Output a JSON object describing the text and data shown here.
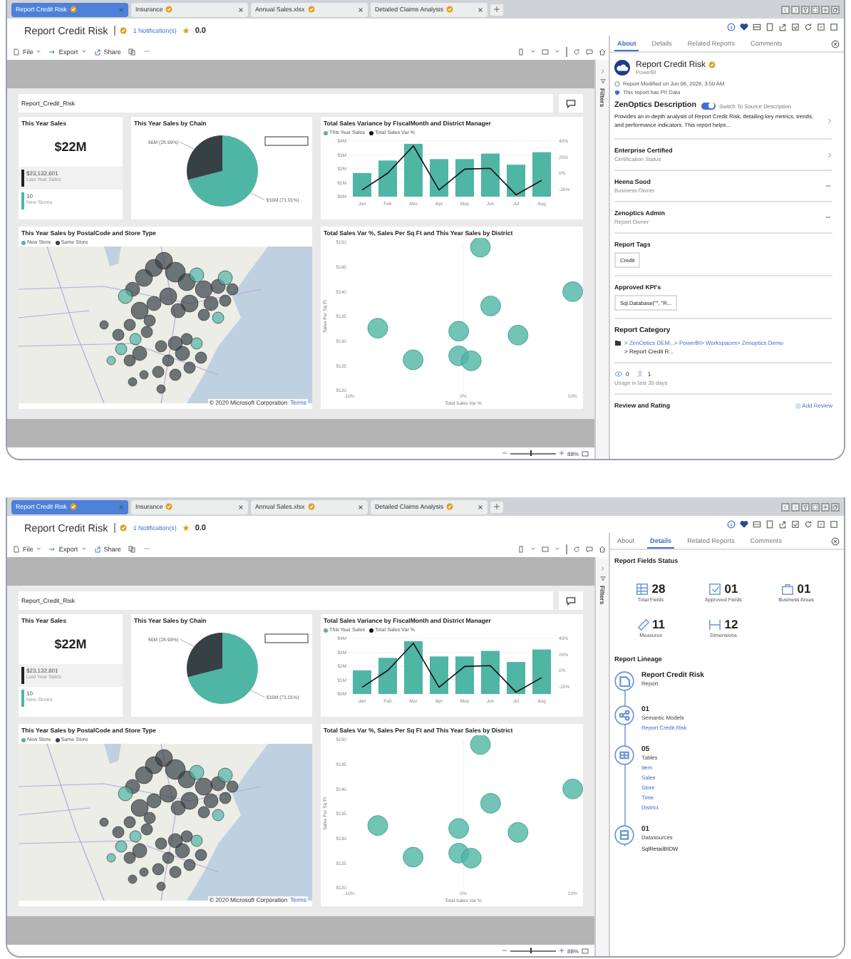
{
  "windows": [
    {
      "tabs": [
        {
          "label": "Report Credit Risk",
          "selected": true
        },
        {
          "label": "Insurance",
          "selected": false
        },
        {
          "label": "Annual Sales.xlsx",
          "selected": false
        },
        {
          "label": "Detailed Claims Analysis",
          "selected": false
        }
      ],
      "title": "Report Credit Risk",
      "notifications": "1 Notification(s)",
      "rating": "0.0",
      "toolbar": [
        {
          "label": "File",
          "dropdown": true
        },
        {
          "label": "Export",
          "dropdown": true
        },
        {
          "label": "Share",
          "dropdown": false
        }
      ],
      "report_name": "Report_Credit_Risk",
      "filters": "Filters",
      "dashboard": {
        "kpi": {
          "title": "This Year Sales",
          "value": "$22M",
          "rows": [
            {
              "value": "$23,132,601",
              "label": "Last Year Sales",
              "color": "#222222"
            },
            {
              "value": "10",
              "label": "New Stores",
              "color": "#4fb5a5"
            }
          ]
        },
        "pie": {
          "title": "This Year Sales by Chain",
          "chart_data": {
            "type": "pie",
            "values": [
              71.01,
              28.99
            ],
            "colors": [
              "#4fb5a5",
              "#374045"
            ],
            "value_labels": [
              "$16M (71.01%)",
              "$6M (28.99%)"
            ]
          }
        },
        "bar": {
          "title": "Total Sales Variance by FiscalMonth and District Manager",
          "chart_data": {
            "type": "bar",
            "categories": [
              "Jan",
              "Feb",
              "Mar",
              "Apr",
              "May",
              "Jun",
              "Jul",
              "Aug"
            ],
            "grid": true,
            "series": [
              {
                "name": "This Year Sales",
                "color": "#4fb5a5",
                "values": [
                  1.7,
                  2.6,
                  3.8,
                  2.7,
                  2.7,
                  3.1,
                  2.3,
                  3.2
                ]
              },
              {
                "name": "Total Sales Var %",
                "type": "line",
                "axis": "y2",
                "color": "#111111",
                "values": [
                  -21,
                  0,
                  34,
                  -21,
                  5,
                  6,
                  -27,
                  -9
                ]
              }
            ],
            "ylim": [
              0,
              4
            ],
            "yticks": [
              {
                "value": 0,
                "label": "$0M"
              },
              {
                "value": 1,
                "label": "$1M"
              },
              {
                "value": 2,
                "label": "$2M"
              },
              {
                "value": 3,
                "label": "$3M"
              },
              {
                "value": 4,
                "label": "$4M"
              }
            ],
            "y2lim": [
              -29.3,
              40
            ],
            "y2ticks": [
              {
                "value": -20,
                "label": "-20%"
              },
              {
                "value": 0,
                "label": "0%"
              },
              {
                "value": 20,
                "label": "20%"
              },
              {
                "value": 40,
                "label": "40%"
              }
            ]
          }
        },
        "map": {
          "title": "This Year Sales by PostalCode and Store Type",
          "legend": [
            {
              "label": "New Store",
              "color": "#4fb5a5"
            },
            {
              "label": "Same Store",
              "color": "#374045"
            }
          ],
          "copyright": "© 2020 Microsoft Corporation",
          "terms": "Terms"
        },
        "scatter": {
          "title": "Total Sales Var %, Sales Per Sq Ft and This Year Sales by District",
          "chart_data": {
            "type": "scatter",
            "xlabel": "Total Sales Var %",
            "ylabel": "Sales Per Sq Ft",
            "x": [
              1.5,
              9.6,
              2.4,
              -7.5,
              -0.4,
              4.8,
              -4.4,
              -0.4,
              0.7
            ],
            "series": [
              {
                "color": "#4fb5a5",
                "values": [
                  149,
                  140,
                  137.1,
                  132.6,
                  132,
                  131.2,
                  126.2,
                  127,
                  126
                ]
              }
            ],
            "xlim": [
              -10,
              10
            ],
            "ylim": [
              120,
              150
            ],
            "xticks": [
              {
                "value": -10,
                "label": "-10%"
              },
              {
                "value": 0,
                "label": "0%"
              },
              {
                "value": 10,
                "label": "10%"
              }
            ],
            "yticks": [
              {
                "value": 120,
                "label": "$120"
              },
              {
                "value": 125,
                "label": "$125"
              },
              {
                "value": 130,
                "label": "$130"
              },
              {
                "value": 135,
                "label": "$135"
              },
              {
                "value": 140,
                "label": "$140"
              },
              {
                "value": 145,
                "label": "$145"
              },
              {
                "value": 150,
                "label": "$150"
              }
            ]
          }
        }
      },
      "zoom": {
        "level": 0.45,
        "reading": "88%"
      },
      "panel": {
        "kind": "about",
        "tabs": [
          {
            "label": "About",
            "selected": true
          },
          {
            "label": "Details",
            "selected": false
          },
          {
            "label": "Related Reports",
            "selected": false
          },
          {
            "label": "Comments",
            "selected": false
          }
        ],
        "name": "Report Credit Risk",
        "source": "PowerBI",
        "modified": "Report Modified on Jun 06, 2026, 3:50 AM",
        "pii": "This report has PII Data",
        "description": {
          "title": "ZenOptics Description",
          "switch_on": true,
          "switch_label": "Switch To Source Description",
          "text": "Provides an in-depth analysis of Report Credit Risk, detailing key metrics, trends, and performance indicators. This report helps..."
        },
        "rows": [
          {
            "title": "Enterprise Certified",
            "subtitle": "Certification Status",
            "kind": "chevron"
          },
          {
            "title": "Heena Sood",
            "subtitle": "Business Owner",
            "kind": "more"
          },
          {
            "title": "Zenoptics Admin",
            "subtitle": "Report Owner",
            "kind": "more"
          }
        ],
        "tags": {
          "title": "Report Tags",
          "items": [
            "Credit"
          ]
        },
        "kpis": {
          "title": "Approved KPI's",
          "items": [
            "Sql.Database(\"\", \"R..."
          ]
        },
        "category": {
          "title": "Report Category",
          "path": "> ZenOptics DEM...> PowerBI> Workspaces> Zenoptics Demo",
          "tail": "> Report Credit R..."
        },
        "usage": {
          "views": "0",
          "users": "1",
          "label": "Usage in last 30 days"
        },
        "review": {
          "title": "Review and Rating",
          "action": "Add Review"
        }
      }
    },
    {
      "tabs": [
        {
          "label": "Report Credit Risk",
          "selected": true
        },
        {
          "label": "Insurance",
          "selected": false
        },
        {
          "label": "Annual Sales.xlsx",
          "selected": false
        },
        {
          "label": "Detailed Claims Analysis",
          "selected": false
        }
      ],
      "title": "Report Credit Risk",
      "notifications": "1 Notification(s)",
      "rating": "0.0",
      "toolbar": [
        {
          "label": "File",
          "dropdown": true
        },
        {
          "label": "Export",
          "dropdown": true
        },
        {
          "label": "Share",
          "dropdown": false
        }
      ],
      "report_name": "Report_Credit_Risk",
      "filters": "Filters",
      "dashboard": {
        "kpi": {
          "title": "This Year Sales",
          "value": "$22M",
          "rows": [
            {
              "value": "$23,132,601",
              "label": "Last Year Sales",
              "color": "#222222"
            },
            {
              "value": "10",
              "label": "New Stores",
              "color": "#4fb5a5"
            }
          ]
        },
        "pie": {
          "title": "This Year Sales by Chain",
          "chart_data": {
            "type": "pie",
            "values": [
              71.01,
              28.99
            ],
            "colors": [
              "#4fb5a5",
              "#374045"
            ],
            "value_labels": [
              "$16M (71.01%)",
              "$6M (28.99%)"
            ]
          }
        },
        "bar": {
          "title": "Total Sales Variance by FiscalMonth and District Manager",
          "chart_data": {
            "type": "bar",
            "categories": [
              "Jan",
              "Feb",
              "Mar",
              "Apr",
              "May",
              "Jun",
              "Jul",
              "Aug"
            ],
            "grid": true,
            "series": [
              {
                "name": "This Year Sales",
                "color": "#4fb5a5",
                "values": [
                  1.7,
                  2.6,
                  3.8,
                  2.7,
                  2.7,
                  3.1,
                  2.3,
                  3.2
                ]
              },
              {
                "name": "Total Sales Var %",
                "type": "line",
                "axis": "y2",
                "color": "#111111",
                "values": [
                  -21,
                  0,
                  34,
                  -21,
                  5,
                  6,
                  -27,
                  -9
                ]
              }
            ],
            "ylim": [
              0,
              4
            ],
            "yticks": [
              {
                "value": 0,
                "label": "$0M"
              },
              {
                "value": 1,
                "label": "$1M"
              },
              {
                "value": 2,
                "label": "$2M"
              },
              {
                "value": 3,
                "label": "$3M"
              },
              {
                "value": 4,
                "label": "$4M"
              }
            ],
            "y2lim": [
              -29.3,
              40
            ],
            "y2ticks": [
              {
                "value": -20,
                "label": "-20%"
              },
              {
                "value": 0,
                "label": "0%"
              },
              {
                "value": 20,
                "label": "20%"
              },
              {
                "value": 40,
                "label": "40%"
              }
            ]
          }
        },
        "map": {
          "title": "This Year Sales by PostalCode and Store Type",
          "legend": [
            {
              "label": "New Store",
              "color": "#4fb5a5"
            },
            {
              "label": "Same Store",
              "color": "#374045"
            }
          ],
          "copyright": "© 2020 Microsoft Corporation",
          "terms": "Terms"
        },
        "scatter": {
          "title": "Total Sales Var %, Sales Per Sq Ft and This Year Sales by District",
          "chart_data": {
            "type": "scatter",
            "xlabel": "Total Sales Var %",
            "ylabel": "Sales Per Sq Ft",
            "x": [
              1.5,
              9.6,
              2.4,
              -7.5,
              -0.4,
              4.8,
              -4.4,
              -0.4,
              0.7
            ],
            "series": [
              {
                "color": "#4fb5a5",
                "values": [
                  149,
                  140,
                  137.1,
                  132.6,
                  132,
                  131.2,
                  126.2,
                  127,
                  126
                ]
              }
            ],
            "xlim": [
              -10,
              10
            ],
            "ylim": [
              120,
              150
            ],
            "xticks": [
              {
                "value": -10,
                "label": "-10%"
              },
              {
                "value": 0,
                "label": "0%"
              },
              {
                "value": 10,
                "label": "10%"
              }
            ],
            "yticks": [
              {
                "value": 120,
                "label": "$120"
              },
              {
                "value": 125,
                "label": "$125"
              },
              {
                "value": 130,
                "label": "$130"
              },
              {
                "value": 135,
                "label": "$135"
              },
              {
                "value": 140,
                "label": "$140"
              },
              {
                "value": 145,
                "label": "$145"
              },
              {
                "value": 150,
                "label": "$150"
              }
            ]
          }
        }
      },
      "zoom": {
        "level": 0.45,
        "reading": "88%"
      },
      "panel": {
        "kind": "details",
        "tabs": [
          {
            "label": "About",
            "selected": false
          },
          {
            "label": "Details",
            "selected": true
          },
          {
            "label": "Related Reports",
            "selected": false
          },
          {
            "label": "Comments",
            "selected": false
          }
        ],
        "fields_title": "Report Fields Status",
        "stats": [
          {
            "value": "28",
            "label": "Total Fields"
          },
          {
            "value": "01",
            "label": "Approved Fields"
          },
          {
            "value": "01",
            "label": "Business Areas"
          },
          {
            "value": "11",
            "label": "Measures"
          },
          {
            "value": "12",
            "label": "Dimensions"
          }
        ],
        "lineage_title": "Report Lineage",
        "lineage": [
          {
            "title": "Report Credit Risk",
            "subtitle": "Report"
          },
          {
            "title": "01",
            "subtitle": "Semantic Models",
            "links": [
              "Report Credit Risk"
            ]
          },
          {
            "title": "05",
            "subtitle": "Tables",
            "links": [
              "Item",
              "Sales",
              "Store",
              "Time",
              "District"
            ]
          },
          {
            "title": "01",
            "subtitle": "Datasources",
            "items": [
              "SqlRetailBIDW"
            ]
          }
        ]
      }
    }
  ]
}
